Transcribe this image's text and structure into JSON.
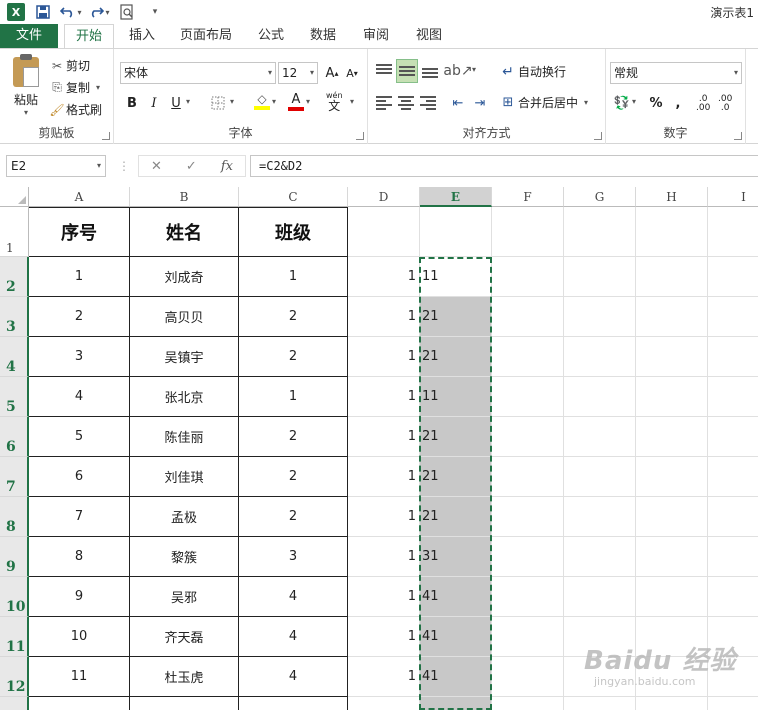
{
  "app": {
    "title": "演示表1",
    "logo": "X"
  },
  "tabs": [
    {
      "label": "文件"
    },
    {
      "label": "开始"
    },
    {
      "label": "插入"
    },
    {
      "label": "页面布局"
    },
    {
      "label": "公式"
    },
    {
      "label": "数据"
    },
    {
      "label": "审阅"
    },
    {
      "label": "视图"
    }
  ],
  "ribbon": {
    "clipboard": {
      "paste": "粘贴",
      "cut": "剪切",
      "copy": "复制",
      "format_painter": "格式刷",
      "group": "剪贴板"
    },
    "font": {
      "name": "宋体",
      "size": "12",
      "grow": "A",
      "shrink": "A",
      "bold": "B",
      "italic": "I",
      "underline": "U",
      "font_color": "A",
      "phonetic_top": "wén",
      "phonetic_bottom": "文",
      "group": "字体"
    },
    "alignment": {
      "wrap": "自动换行",
      "merge": "合并后居中",
      "group": "对齐方式"
    },
    "number": {
      "format": "常规",
      "percent": "%",
      "comma": ",",
      "inc_decimal": ".00",
      "dec_decimal": ".0",
      "group": "数字"
    }
  },
  "formula_bar": {
    "name_box": "E2",
    "formula": "=C2&D2",
    "cancel": "✕",
    "enter": "✓",
    "fx": "fx"
  },
  "columns": [
    "A",
    "B",
    "C",
    "D",
    "E",
    "F",
    "G",
    "H",
    "I"
  ],
  "header_row": [
    "序号",
    "姓名",
    "班级"
  ],
  "rows": [
    {
      "num": "1",
      "name": "刘成奇",
      "class": "1",
      "d": "1",
      "e": "11"
    },
    {
      "num": "2",
      "name": "高贝贝",
      "class": "2",
      "d": "1",
      "e": "21"
    },
    {
      "num": "3",
      "name": "吴镇宇",
      "class": "2",
      "d": "1",
      "e": "21"
    },
    {
      "num": "4",
      "name": "张北京",
      "class": "1",
      "d": "1",
      "e": "11"
    },
    {
      "num": "5",
      "name": "陈佳丽",
      "class": "2",
      "d": "1",
      "e": "21"
    },
    {
      "num": "6",
      "name": "刘佳琪",
      "class": "2",
      "d": "1",
      "e": "21"
    },
    {
      "num": "7",
      "name": "孟极",
      "class": "2",
      "d": "1",
      "e": "21"
    },
    {
      "num": "8",
      "name": "黎簇",
      "class": "3",
      "d": "1",
      "e": "31"
    },
    {
      "num": "9",
      "name": "吴邪",
      "class": "4",
      "d": "1",
      "e": "41"
    },
    {
      "num": "10",
      "name": "齐天磊",
      "class": "4",
      "d": "1",
      "e": "41"
    },
    {
      "num": "11",
      "name": "杜玉虎",
      "class": "4",
      "d": "1",
      "e": "41"
    }
  ],
  "row_numbers": [
    "1",
    "2",
    "3",
    "4",
    "5",
    "6",
    "7",
    "8",
    "9",
    "10",
    "11",
    "12"
  ],
  "watermark": {
    "main": "Baidu 经验",
    "sub": "jingyan.baidu.com"
  },
  "colors": {
    "accent": "#217346",
    "selection_fill": "#c8c8c8"
  }
}
